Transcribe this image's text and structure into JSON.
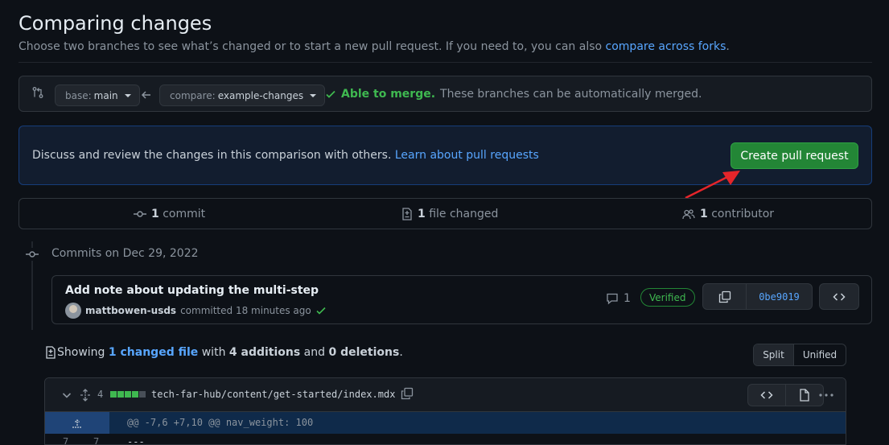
{
  "header": {
    "title": "Comparing changes",
    "subtitle_prefix": "Choose two branches to see what’s changed or to start a new pull request. If you need to, you can also",
    "subtitle_link": "compare across forks",
    "subtitle_suffix": "."
  },
  "range": {
    "base_label": "base:",
    "base_value": "main",
    "compare_label": "compare:",
    "compare_value": "example-changes",
    "merge_status": "Able to merge.",
    "merge_detail": "These branches can be automatically merged."
  },
  "blankslate": {
    "text": "Discuss and review the changes in this comparison with others.",
    "link": "Learn about pull requests",
    "button": "Create pull request"
  },
  "stats": {
    "commits_count": "1",
    "commits_label": "commit",
    "files_count": "1",
    "files_label": "file changed",
    "contributors_count": "1",
    "contributors_label": "contributor"
  },
  "commits": {
    "date_heading": "Commits on Dec 29, 2022",
    "items": [
      {
        "title": "Add note about updating the multi-step",
        "author": "mattbowen-usds",
        "meta": "committed 18 minutes ago",
        "comments": "1",
        "badge": "Verified",
        "sha": "0be9019"
      }
    ]
  },
  "toc": {
    "prefix": "Showing",
    "files_link": "1 changed file",
    "with": "with",
    "additions": "4 additions",
    "and": "and",
    "deletions": "0 deletions",
    "suffix": "."
  },
  "view_toggle": {
    "split": "Split",
    "unified": "Unified"
  },
  "file": {
    "change_count": "4",
    "diffstat": [
      "add",
      "add",
      "add",
      "add",
      "neutral"
    ],
    "path": "tech-far-hub/content/get-started/index.mdx",
    "hunk": "@@ -7,6 +7,10 @@ nav_weight: 100",
    "lines": [
      {
        "old": "7",
        "new": "7",
        "code": "---"
      }
    ]
  },
  "colors": {
    "accent": "#58a6ff",
    "success": "#3fb950",
    "primary_button": "#238636",
    "annotation_arrow": "#e5252a"
  }
}
